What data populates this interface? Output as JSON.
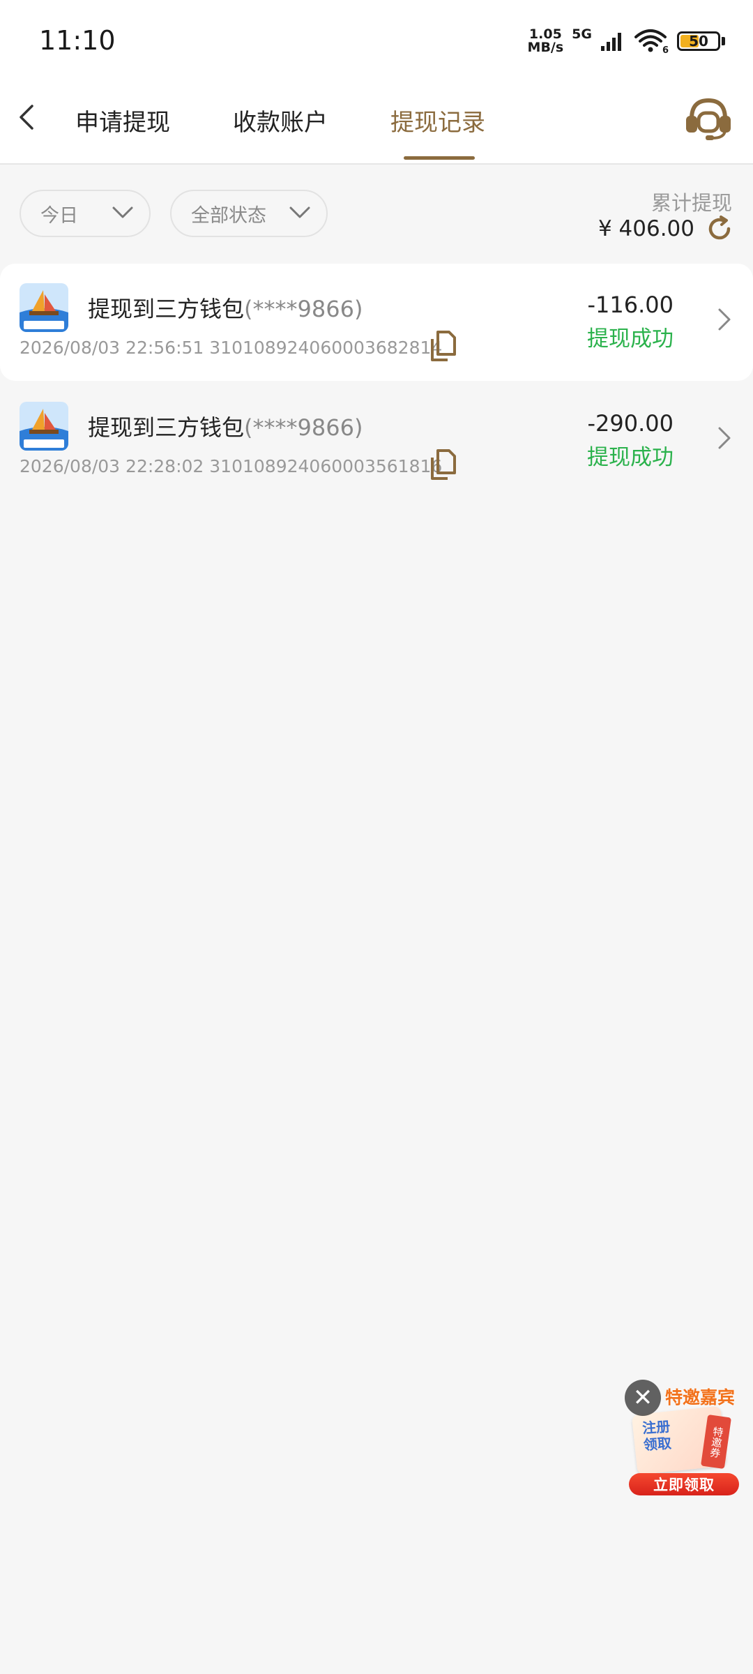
{
  "status_bar": {
    "time": "11:10",
    "net_speed_value": "1.05",
    "net_speed_unit": "MB/s",
    "network": "5G",
    "wifi_badge": "6",
    "battery": "50",
    "battery_level": 0.5
  },
  "header": {
    "tabs": [
      {
        "label": "申请提现",
        "active": false
      },
      {
        "label": "收款账户",
        "active": false
      },
      {
        "label": "提现记录",
        "active": true
      }
    ],
    "accent_color": "#8b6b3e"
  },
  "filters": {
    "date": "今日",
    "status": "全部状态"
  },
  "summary": {
    "label": "累计提现",
    "amount": "¥ 406.00"
  },
  "records": [
    {
      "title": "提现到三方钱包",
      "account": "(****9866)",
      "datetime": "2026/08/03 22:56:51",
      "order_no": "3101089240600036828​14",
      "amount": "-116.00",
      "status": "提现成功"
    },
    {
      "title": "提现到三方钱包",
      "account": "(****9866)",
      "datetime": "2026/08/03 22:28:02",
      "order_no": "310108924060003561816",
      "amount": "-290.00",
      "status": "提现成功"
    }
  ],
  "promo": {
    "title": "特邀嘉宾",
    "card_text": "注册领取",
    "tag_text": "特邀券",
    "button": "立即领取",
    "close": "✕"
  },
  "colors": {
    "success": "#2bb24c",
    "promo_red": "#e0261d"
  }
}
